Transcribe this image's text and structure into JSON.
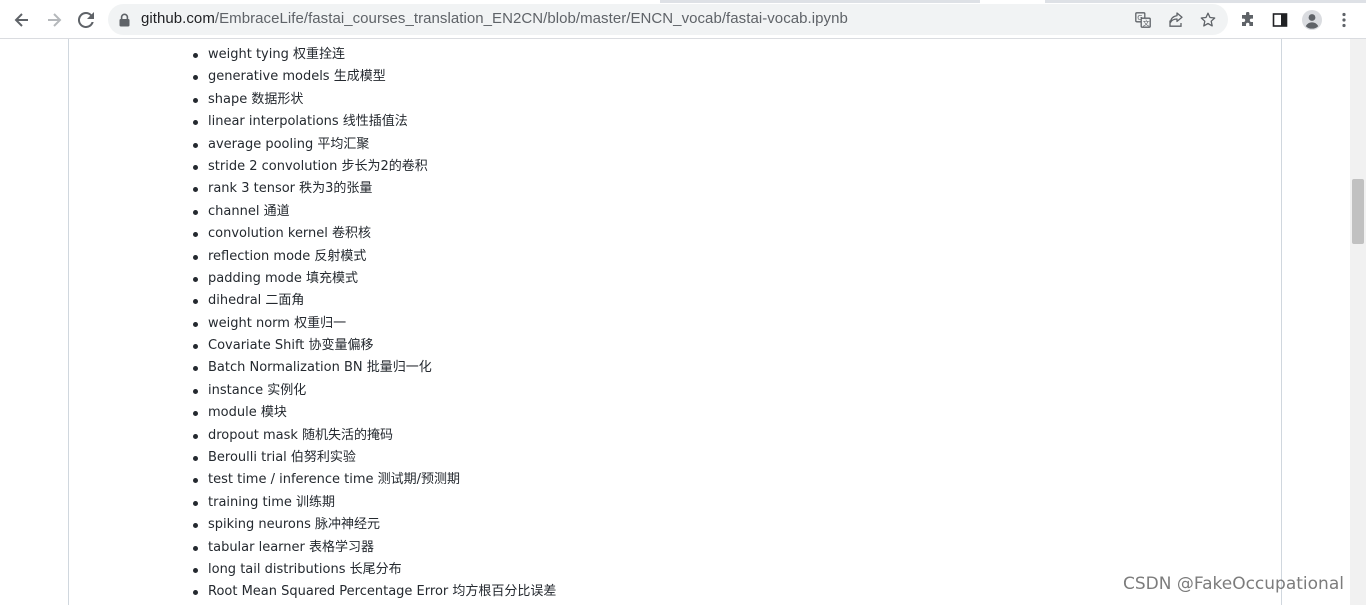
{
  "browser": {
    "url_host": "github.com",
    "url_path": "/EmbraceLife/fastai_courses_translation_EN2CN/blob/master/ENCN_vocab/fastai-vocab.ipynb",
    "icons": [
      "back-arrow-icon",
      "forward-arrow-icon",
      "reload-icon",
      "lock-icon",
      "translate-icon",
      "share-icon",
      "star-icon",
      "extensions-icon",
      "side-panel-icon",
      "profile-icon",
      "menu-icon"
    ]
  },
  "vocab": [
    "weight tying 权重拴连",
    "generative models 生成模型",
    "shape 数据形状",
    "linear interpolations 线性插值法",
    "average pooling 平均汇聚",
    "stride 2 convolution 步长为2的卷积",
    "rank 3 tensor 秩为3的张量",
    "channel 通道",
    "convolution kernel 卷积核",
    "reflection mode 反射模式",
    "padding mode 填充模式",
    "dihedral 二面角",
    "weight norm 权重归一",
    "Covariate Shift 协变量偏移",
    "Batch Normalization BN 批量归一化",
    "instance 实例化",
    "module 模块",
    "dropout mask 随机失活的掩码",
    "Beroulli trial 伯努利实验",
    "test time / inference time 测试期/预测期",
    "training time 训练期",
    "spiking neurons 脉冲神经元",
    "tabular learner 表格学习器",
    "long tail distributions 长尾分布",
    "Root Mean Squared Percentage Error 均方根百分比误差"
  ],
  "watermark": "CSDN @FakeOccupational"
}
